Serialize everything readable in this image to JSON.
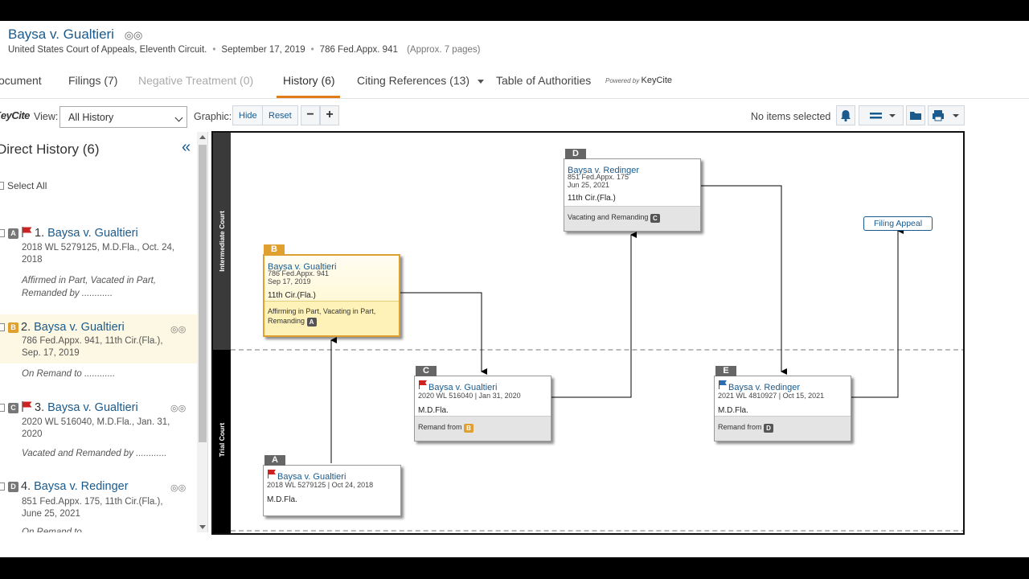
{
  "header": {
    "title": "Baysa v. Gualtieri",
    "court": "United States Court of Appeals, Eleventh Circuit.",
    "date": "September 17, 2019",
    "citation": "786 Fed.Appx. 941",
    "pages": "(Approx. 7 pages)"
  },
  "tabs": {
    "document": "ocument",
    "filings": "Filings (7)",
    "negative": "Negative Treatment (0)",
    "history": "History (6)",
    "citing": "Citing References (13)",
    "authorities": "Table of Authorities",
    "powered_by": "Powered by",
    "keycite": "KeyCite"
  },
  "toolbar": {
    "logo": "KeyCite",
    "view_label": "View:",
    "view_value": "All History",
    "graphic_label": "Graphic:",
    "hide": "Hide",
    "reset": "Reset",
    "zoom_out": "−",
    "zoom_in": "+",
    "status": "No items selected"
  },
  "history_panel": {
    "title": "Direct History (6)",
    "select_all": "Select All",
    "entries": [
      {
        "letter": "A",
        "num": "1.",
        "name": "Baysa v. Gualtieri",
        "cite": "2018 WL 5279125, M.D.Fla., Oct. 24, 2018",
        "treatment": "Affirmed in Part, Vacated in Part, Remanded by ............"
      },
      {
        "letter": "B",
        "num": "2.",
        "name": "Baysa v. Gualtieri",
        "cite": "786 Fed.Appx. 941, 11th Cir.(Fla.), Sep. 17, 2019",
        "treatment": "On Remand to ............"
      },
      {
        "letter": "C",
        "num": "3.",
        "name": "Baysa v. Gualtieri",
        "cite": "2020 WL 516040, M.D.Fla., Jan. 31, 2020",
        "treatment": "Vacated and Remanded by ............"
      },
      {
        "letter": "D",
        "num": "4.",
        "name": "Baysa v. Redinger",
        "cite": "851 Fed.Appx. 175, 11th Cir.(Fla.), June 25, 2021",
        "treatment": "On Remand to ............"
      }
    ]
  },
  "graph": {
    "court_labels": {
      "intermediate": "Intermediate Court",
      "trial": "Trial Court"
    },
    "nodes": {
      "A": {
        "title": "Baysa v. Gualtieri",
        "cite": "2018 WL 5279125   |   Oct 24, 2018",
        "court": "M.D.Fla."
      },
      "B": {
        "title": "Baysa v. Gualtieri",
        "cite1": "786 Fed.Appx. 941",
        "cite2": "Sep 17, 2019",
        "court": "11th Cir.(Fla.)",
        "treat": "Affirming in Part, Vacating in Part, Remanding"
      },
      "C": {
        "title": "Baysa v. Gualtieri",
        "cite": "2020 WL 516040   |   Jan 31, 2020",
        "court": "M.D.Fla.",
        "treat": "Remand from"
      },
      "D": {
        "title": "Baysa v. Redinger",
        "cite1": "851 Fed.Appx. 175",
        "cite2": "Jun 25, 2021",
        "court": "11th Cir.(Fla.)",
        "treat": "Vacating and Remanding"
      },
      "E": {
        "title": "Baysa v. Redinger",
        "cite": "2021 WL 4810927   |   Oct 15, 2021",
        "court": "M.D.Fla.",
        "treat": "Remand from"
      }
    },
    "filing_appeal": "Filing Appeal"
  },
  "colors": {
    "link": "#1a5a8c",
    "accent": "#e07b1a",
    "selected_letter": "#e0a030",
    "letter_gray": "#777777",
    "flag_red": "#cc2222",
    "flag_blue": "#2a6db0"
  }
}
